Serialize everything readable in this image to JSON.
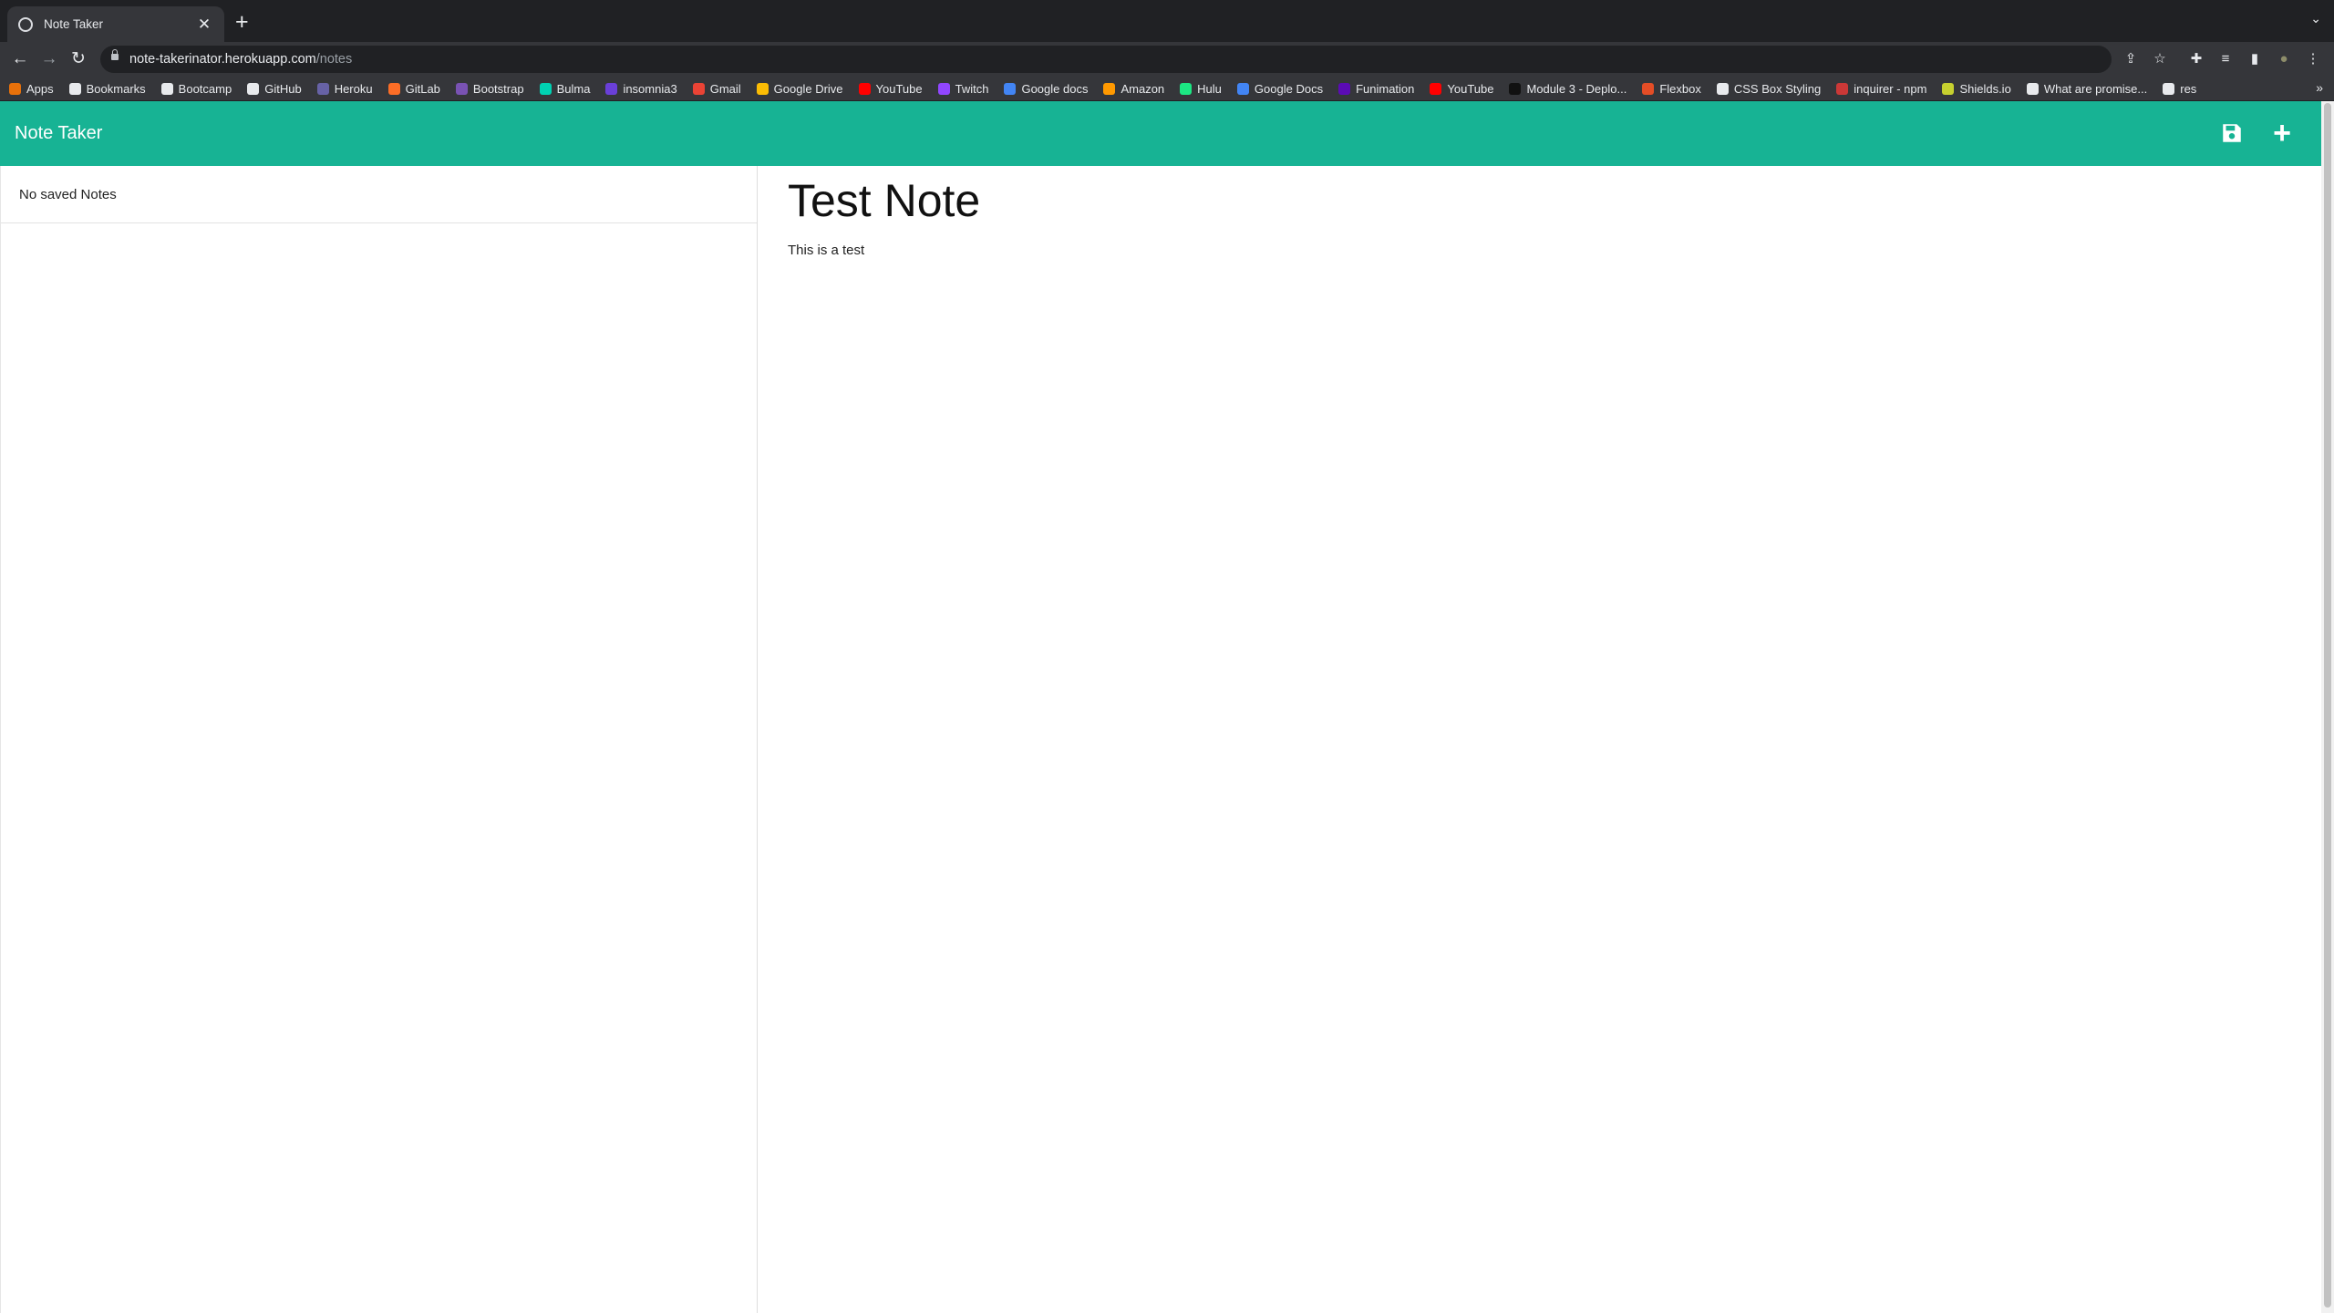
{
  "browser": {
    "tab_title": "Note Taker",
    "tab_close": "✕",
    "new_tab": "+",
    "tab_menu": "⌄",
    "url_host": "note-takerinator.herokuapp.com",
    "url_path": "/notes",
    "back": "←",
    "forward": "→",
    "reload": "↻",
    "icons": {
      "share": "⇪",
      "star": "☆",
      "extensions": "✚",
      "media": "≡",
      "sidepanel": "▮",
      "profile": "●",
      "menu": "⋮"
    },
    "bookmarks_more": "»",
    "bookmarks": [
      {
        "label": "Apps",
        "color": "#e8710a"
      },
      {
        "label": "Bookmarks",
        "color": "#e8eaed"
      },
      {
        "label": "Bootcamp",
        "color": "#e8eaed"
      },
      {
        "label": "GitHub",
        "color": "#e8eaed"
      },
      {
        "label": "Heroku",
        "color": "#6762a6"
      },
      {
        "label": "GitLab",
        "color": "#fc6d26"
      },
      {
        "label": "Bootstrap",
        "color": "#7952b3"
      },
      {
        "label": "Bulma",
        "color": "#00d1b2"
      },
      {
        "label": "insomnia3",
        "color": "#6a3fd8"
      },
      {
        "label": "Gmail",
        "color": "#ea4335"
      },
      {
        "label": "Google Drive",
        "color": "#fbbc04"
      },
      {
        "label": "YouTube",
        "color": "#ff0000"
      },
      {
        "label": "Twitch",
        "color": "#9146ff"
      },
      {
        "label": "Google docs",
        "color": "#4285f4"
      },
      {
        "label": "Amazon",
        "color": "#ff9900"
      },
      {
        "label": "Hulu",
        "color": "#1ce783"
      },
      {
        "label": "Google Docs",
        "color": "#4285f4"
      },
      {
        "label": "Funimation",
        "color": "#5b0bb5"
      },
      {
        "label": "YouTube",
        "color": "#ff0000"
      },
      {
        "label": "Module 3 - Deplo...",
        "color": "#111111"
      },
      {
        "label": "Flexbox",
        "color": "#e44d26"
      },
      {
        "label": "CSS Box Styling",
        "color": "#e8eaed"
      },
      {
        "label": "inquirer - npm",
        "color": "#cb3837"
      },
      {
        "label": "Shields.io",
        "color": "#c6d02f"
      },
      {
        "label": "What are promise...",
        "color": "#e8eaed"
      },
      {
        "label": "res",
        "color": "#e8eaed"
      }
    ]
  },
  "app": {
    "brand": "Note Taker",
    "add_label": "+",
    "accent_color": "#17b394",
    "empty_list_text": "No saved Notes",
    "note": {
      "title": "Test Note",
      "body": "This is a test"
    }
  }
}
